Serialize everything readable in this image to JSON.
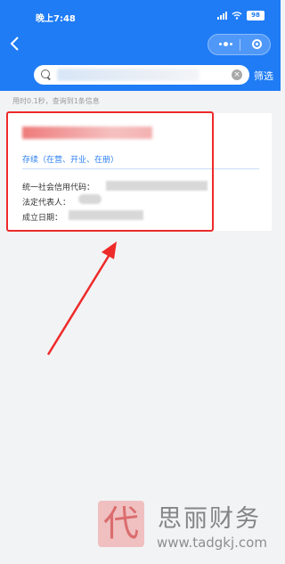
{
  "status_bar": {
    "time": "晚上7:48",
    "battery": "98"
  },
  "nav": {
    "back_icon": "back-chevron-icon",
    "capsule_icons": [
      "more-dots-icon",
      "close-target-icon"
    ]
  },
  "search": {
    "value": "",
    "clear_icon": "clear-icon",
    "filter_label": "筛选"
  },
  "result_info": "用时0.1秒，查询到1条信息",
  "result_card": {
    "company_name": "",
    "status": "存续（在营、开业、在册）",
    "fields": [
      {
        "label": "统一社会信用代码：",
        "value": ""
      },
      {
        "label": "法定代表人：",
        "value": ""
      },
      {
        "label": "成立日期：",
        "value": ""
      }
    ]
  },
  "watermark": {
    "logo_char": "代",
    "brand": "思丽财务",
    "url": "www.tadgkj.com"
  },
  "colors": {
    "header": "#1f7cf5",
    "status_text": "#2d7ff2",
    "highlight": "#ee2a2a"
  }
}
